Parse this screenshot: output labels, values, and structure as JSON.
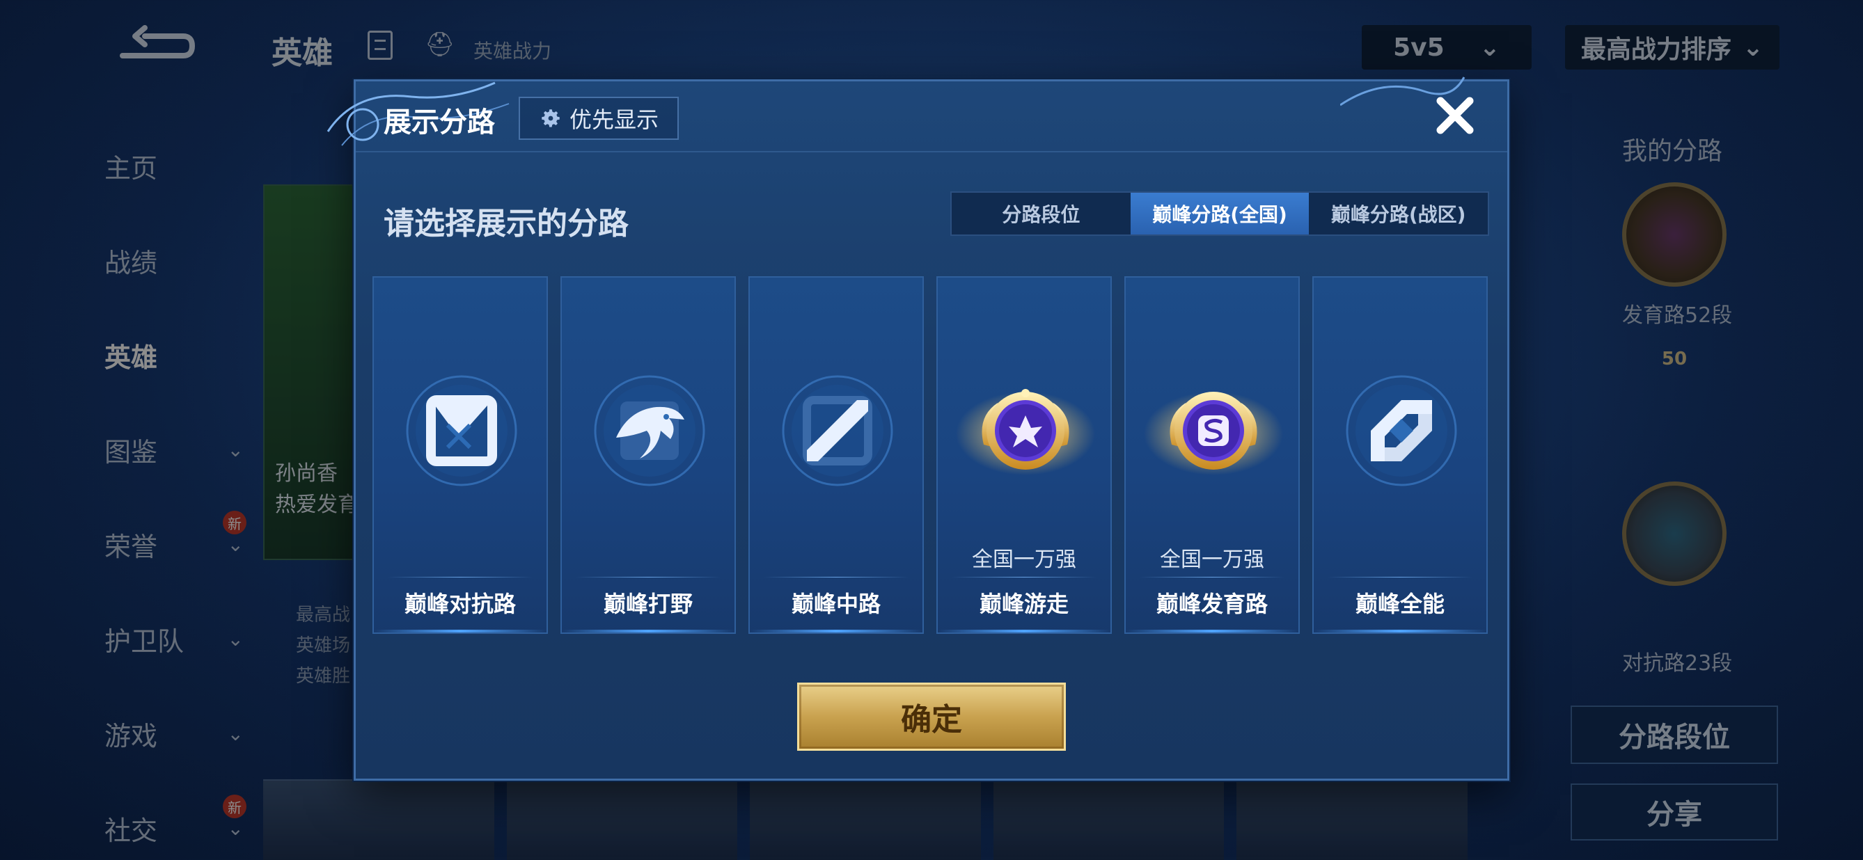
{
  "background": {
    "header": {
      "title": "英雄",
      "power_text": "英雄战力",
      "mode": "5v5",
      "sort": "最高战力排序"
    },
    "nav": [
      {
        "label": "主页"
      },
      {
        "label": "战绩"
      },
      {
        "label": "英雄"
      },
      {
        "label": "图鉴"
      },
      {
        "label": "荣誉",
        "badge": "新"
      },
      {
        "label": "护卫队"
      },
      {
        "label": "游戏"
      },
      {
        "label": "社交",
        "badge": "新"
      }
    ],
    "hero_card": {
      "line1": "孙尚香",
      "line2": "热爱发育"
    },
    "left_info": [
      "最高战",
      "英雄场",
      "英雄胜"
    ],
    "right_panel": {
      "title": "我的分路",
      "lane1_label": "发育路52段",
      "lane1_level": "50",
      "lane2_label": "对抗路23段",
      "btn_rank": "分路段位",
      "btn_share": "分享"
    }
  },
  "modal": {
    "title": "展示分路",
    "priority_label": "优先显示",
    "subtitle": "请选择展示的分路",
    "tabs": [
      {
        "label": "分路段位",
        "active": false
      },
      {
        "label": "巅峰分路(全国)",
        "active": true
      },
      {
        "label": "巅峰分路(战区)",
        "active": false
      }
    ],
    "lanes": [
      {
        "label": "巅峰对抗路",
        "rank": "",
        "icon": "clash-lane-icon"
      },
      {
        "label": "巅峰打野",
        "rank": "",
        "icon": "jungle-dragon-icon"
      },
      {
        "label": "巅峰中路",
        "rank": "",
        "icon": "mid-lane-icon"
      },
      {
        "label": "巅峰游走",
        "rank": "全国一万强",
        "icon": "roam-gold-badge-icon"
      },
      {
        "label": "巅峰发育路",
        "rank": "全国一万强",
        "icon": "farm-gold-badge-icon"
      },
      {
        "label": "巅峰全能",
        "rank": "",
        "icon": "all-round-icon"
      }
    ],
    "confirm_label": "确定"
  },
  "colors": {
    "accent_blue": "#3a7cd0",
    "gold": "#c9a24f",
    "modal_bg": "#1e4779"
  }
}
